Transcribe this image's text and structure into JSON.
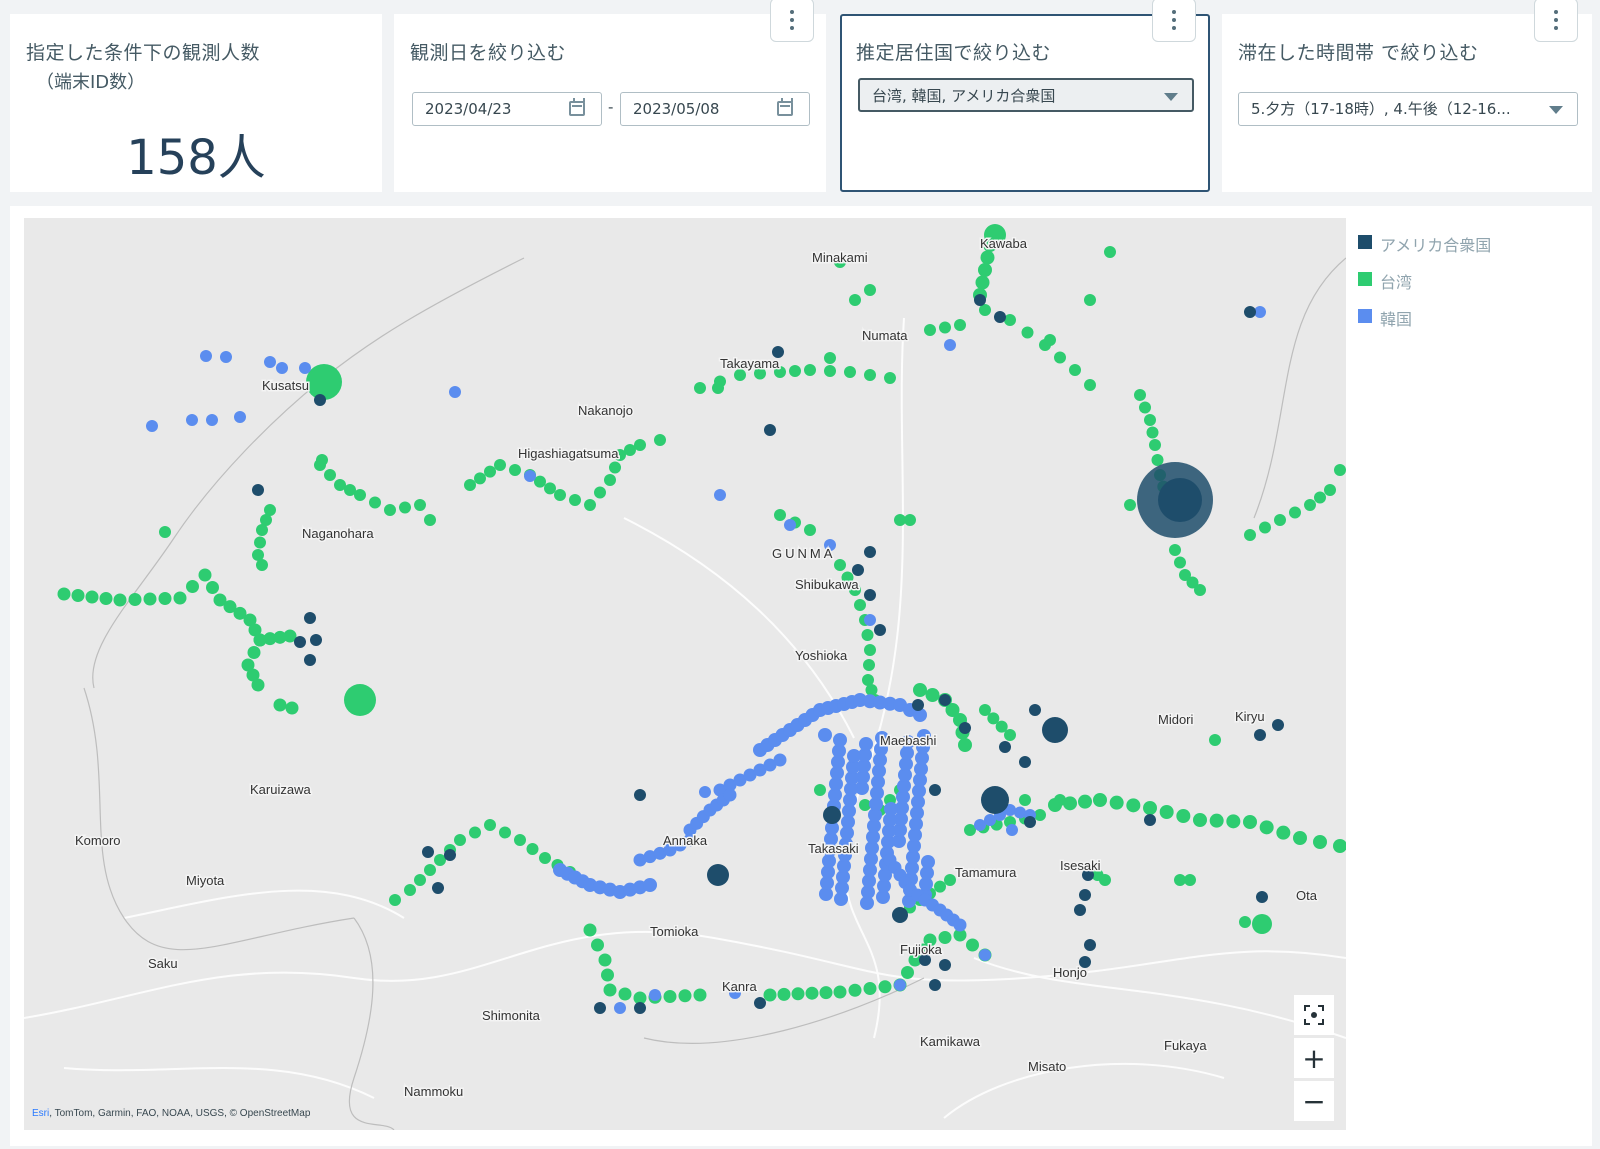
{
  "kpi": {
    "title": "指定した条件下の観測人数",
    "subtitle": "（端末ID数）",
    "value": "158人"
  },
  "date_filter": {
    "title": "観測日を絞り込む",
    "start": "2023/04/23",
    "separator": "-",
    "end": "2023/05/08"
  },
  "country_filter": {
    "title": "推定居住国で絞り込む",
    "value": "台湾, 韓国, アメリカ合衆国"
  },
  "time_filter": {
    "title": "滞在した時間帯 で絞り込む",
    "value": "5.夕方（17-18時）, 4.午後（12-16..."
  },
  "legend": [
    {
      "label": "アメリカ合衆国",
      "color": "#1e4d6b"
    },
    {
      "label": "台湾",
      "color": "#2ecc71"
    },
    {
      "label": "韓国",
      "color": "#5b8def"
    }
  ],
  "map": {
    "places": [
      "Minakami",
      "Kawaba",
      "Numata",
      "Takayama",
      "Kusatsu",
      "Nakanojo",
      "Higashiagatsuma",
      "Naganohara",
      "GUNMA",
      "Shibukawa",
      "Yoshioka",
      "Maebashi",
      "Midori",
      "Kiryu",
      "Karuizawa",
      "Komoro",
      "Miyota",
      "Annaka",
      "Takasaki",
      "Tamamura",
      "Isesaki",
      "Ota",
      "Saku",
      "Tomioka",
      "Kanra",
      "Fujioka",
      "Honjo",
      "Shimonita",
      "Kamikawa",
      "Fukaya",
      "Misato",
      "Nammoku"
    ],
    "attribution_esri": "Esri",
    "attribution_rest": ", TomTom, Garmin, FAO, NOAA, USGS, © OpenStreetMap",
    "zoom_in": "+",
    "zoom_out": "−"
  }
}
